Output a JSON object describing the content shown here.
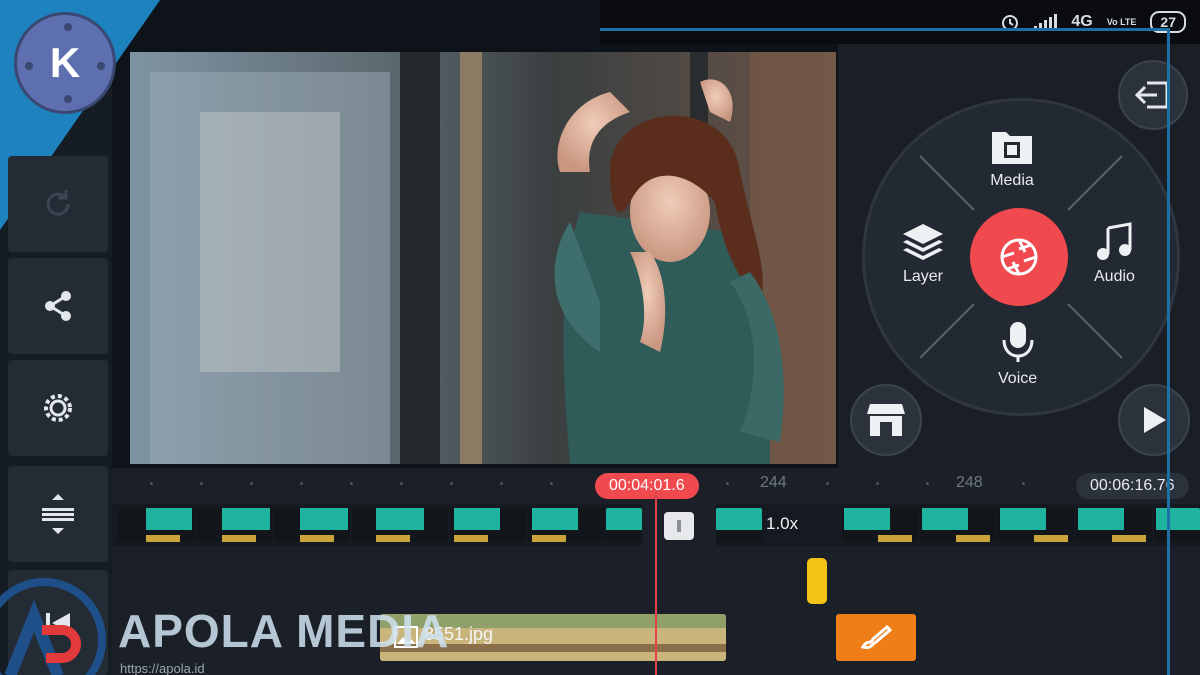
{
  "status_bar": {
    "network": "4G",
    "volte": "Vo LTE",
    "battery": "27"
  },
  "app_logo": "K",
  "sidebar": {
    "items": [
      {
        "icon": "redo-icon"
      },
      {
        "icon": "share-icon"
      },
      {
        "icon": "settings-gear-icon"
      },
      {
        "icon": "timeline-adjust-icon"
      }
    ]
  },
  "wheel": {
    "media_label": "Media",
    "layer_label": "Layer",
    "audio_label": "Audio",
    "voice_label": "Voice"
  },
  "timeline": {
    "current_time": "00:04:01.6",
    "ruler_mark_1": "244",
    "ruler_mark_2": "248",
    "total_time": "00:06:16.76",
    "speed_label": "1.0x",
    "image_layer_name": "8551.jpg"
  },
  "watermark": {
    "brand": "APOLA MEDIA",
    "url": "https://apola.id"
  },
  "colors": {
    "accent_red": "#f04a4f",
    "clip_teal": "#1fb4a0",
    "brand_blue": "#1f8ed0",
    "handwriting_orange": "#f07e18",
    "layer_yellow": "#f3c417"
  }
}
